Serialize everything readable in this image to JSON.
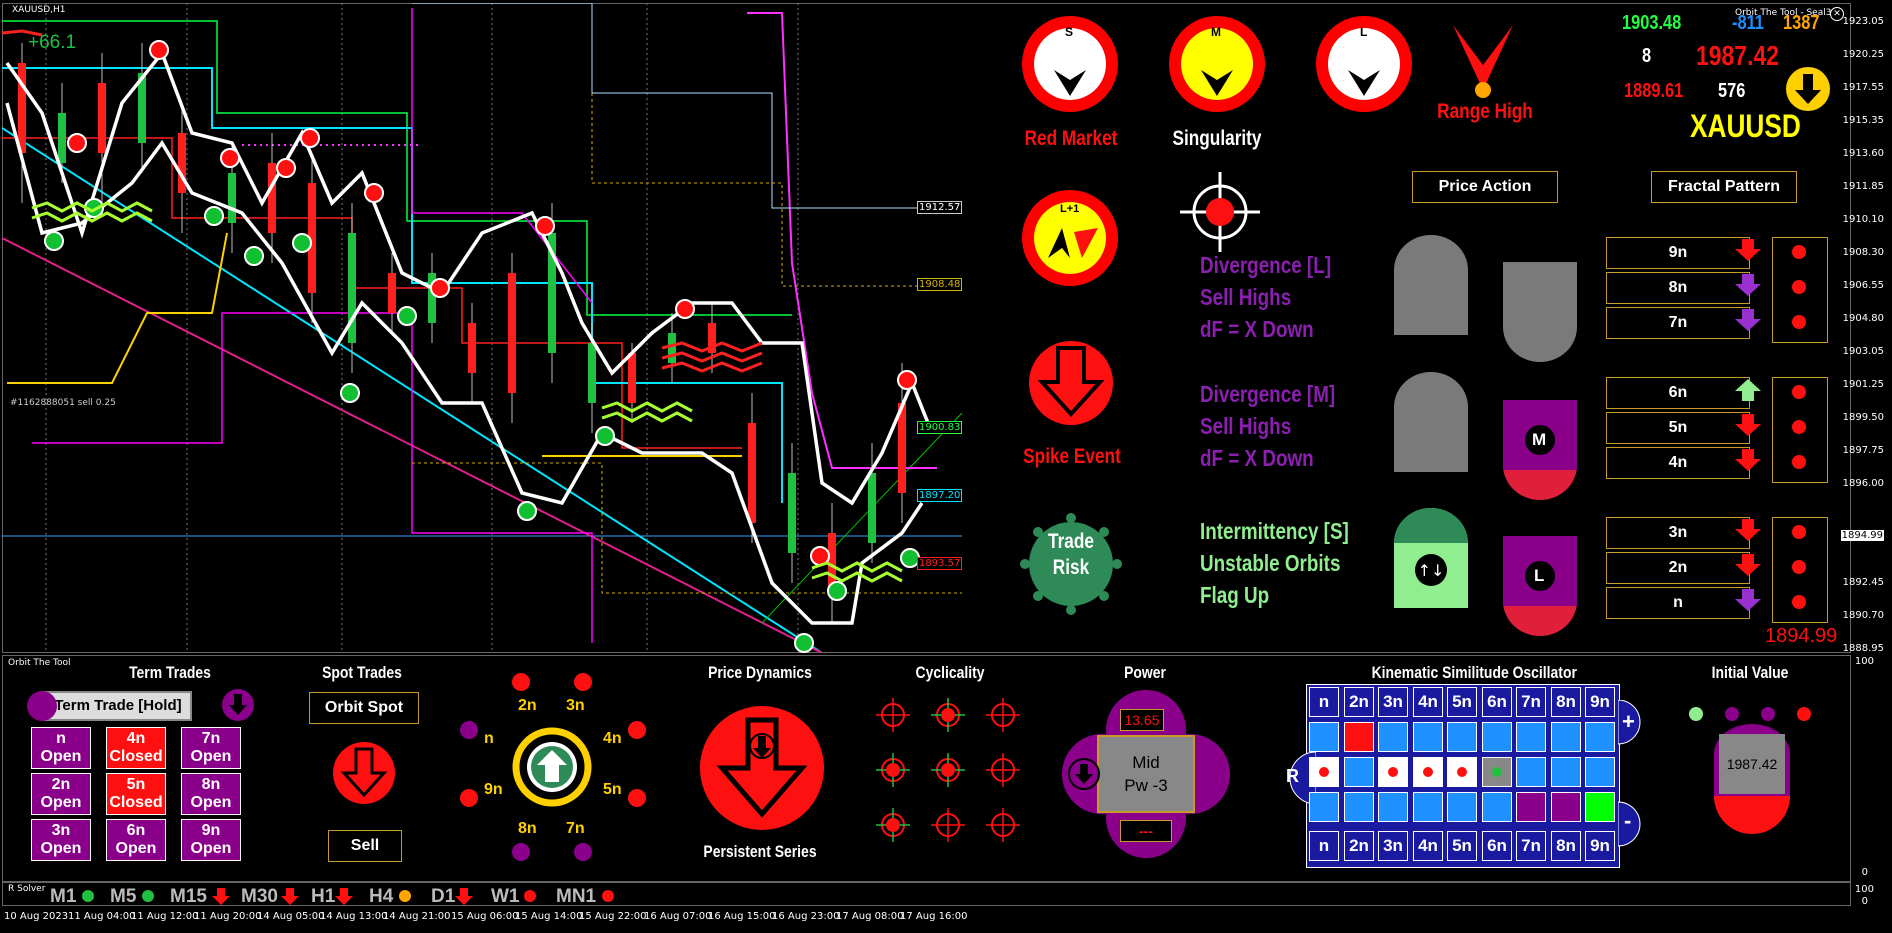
{
  "symbol_title": "XAUUSD,H1",
  "chart_pnl": "+66.1",
  "order_label": "#1162888051 sell 0.25",
  "indicator_name": "Orbit The Tool - Seal3",
  "price_levels": {
    "l1912": "1912.57",
    "l1908": "1908.48",
    "l1900": "1900.83",
    "l1897": "1897.20",
    "l1893": "1893.57",
    "current": "1894.99"
  },
  "y_axis": [
    "1923.05",
    "1920.25",
    "1917.55",
    "1915.35",
    "1913.60",
    "1911.85",
    "1910.10",
    "1908.30",
    "1906.55",
    "1904.80",
    "1903.05",
    "1901.25",
    "1899.50",
    "1897.75",
    "1896.00",
    "1894.99",
    "1892.45",
    "1890.70",
    "1888.95"
  ],
  "sub_axis": [
    "100",
    "0",
    "100",
    "0"
  ],
  "x_axis": [
    "10 Aug 2023",
    "11 Aug 04:00",
    "11 Aug 12:00",
    "11 Aug 20:00",
    "14 Aug 05:00",
    "14 Aug 13:00",
    "14 Aug 21:00",
    "15 Aug 06:00",
    "15 Aug 14:00",
    "15 Aug 22:00",
    "16 Aug 07:00",
    "16 Aug 15:00",
    "16 Aug 23:00",
    "17 Aug 08:00",
    "17 Aug 16:00"
  ],
  "dials": {
    "s_letter": "S",
    "m_letter": "M",
    "l_letter": "L",
    "l1_letter": "L+1",
    "red_market": "Red Market",
    "singularity": "Singularity",
    "range_high": "Range High",
    "spike_event": "Spike Event",
    "trade_risk_1": "Trade",
    "trade_risk_2": "Risk"
  },
  "readout": {
    "v1": "1903.48",
    "v2": "-811",
    "v3": "1387",
    "v4": "8",
    "v5": "1987.42",
    "v6": "1889.61",
    "v7": "576",
    "symbol": "XAUUSD"
  },
  "buttons": {
    "price_action": "Price Action",
    "fractal_pattern": "Fractal Pattern"
  },
  "divergence_l": [
    "Divergence [L]",
    "Sell Highs",
    "dF = X Down"
  ],
  "divergence_m": [
    "Divergence [M]",
    "Sell Highs",
    "dF = X Down"
  ],
  "intermittency": [
    "Intermittency [S]",
    "Unstable Orbits",
    "Flag Up"
  ],
  "shape_m": "M",
  "shape_l": "L",
  "fractals": [
    "9n",
    "8n",
    "7n",
    "6n",
    "5n",
    "4n",
    "3n",
    "2n",
    "n"
  ],
  "fractal_arrows": [
    "red-down",
    "purple-down",
    "purple-down",
    "green-up",
    "red-down",
    "red-down",
    "red-down",
    "red-down",
    "purple-down"
  ],
  "right_price": "1894.99",
  "bottom": {
    "panel_title": "Orbit The Tool",
    "term_trades": "Term Trades",
    "term_trade_hold": "Term Trade [Hold]",
    "grid": [
      {
        "l1": "n",
        "l2": "Open",
        "c": "purple"
      },
      {
        "l1": "4n",
        "l2": "Closed",
        "c": "red"
      },
      {
        "l1": "7n",
        "l2": "Open",
        "c": "purple"
      },
      {
        "l1": "2n",
        "l2": "Open",
        "c": "purple"
      },
      {
        "l1": "5n",
        "l2": "Closed",
        "c": "red"
      },
      {
        "l1": "8n",
        "l2": "Open",
        "c": "purple"
      },
      {
        "l1": "3n",
        "l2": "Open",
        "c": "purple"
      },
      {
        "l1": "6n",
        "l2": "Open",
        "c": "purple"
      },
      {
        "l1": "9n",
        "l2": "Open",
        "c": "purple"
      }
    ],
    "spot_trades": "Spot Trades",
    "orbit_spot": "Orbit Spot",
    "sell": "Sell",
    "orbit_labels": [
      "2n",
      "3n",
      "4n",
      "5n",
      "7n",
      "8n",
      "9n",
      "n"
    ],
    "price_dynamics": "Price Dynamics",
    "persistent_series": "Persistent Series",
    "cyclicality": "Cyclicality",
    "power": "Power",
    "power_value": "13.65",
    "power_mid": "Mid",
    "power_pw": "Pw -3",
    "power_dash": "---",
    "kso_title": "Kinematic Similitude Oscillator",
    "kso_headers": [
      "n",
      "2n",
      "3n",
      "4n",
      "5n",
      "6n",
      "7n",
      "8n",
      "9n"
    ],
    "kso_r": "R",
    "kso_plus": "+",
    "kso_minus": "-",
    "initial_value": "Initial Value",
    "initial_number": "1987.42"
  },
  "solver_label": "R Solver",
  "timeframes": [
    "M1",
    "M5",
    "M15",
    "M30",
    "H1",
    "H4",
    "D1",
    "W1",
    "MN1"
  ],
  "timeframe_status": [
    "green-dot",
    "green-dot",
    "red-arrow",
    "red-arrow",
    "red-arrow",
    "orange-dot",
    "red-arrow",
    "red-dot",
    "red-dot"
  ],
  "colors": {
    "red": "#ff1010",
    "yellow": "#ffff00",
    "purple": "#8b008b",
    "green": "#00cc44",
    "gold_border": "#c89a2a",
    "blue": "#1e90ff"
  }
}
